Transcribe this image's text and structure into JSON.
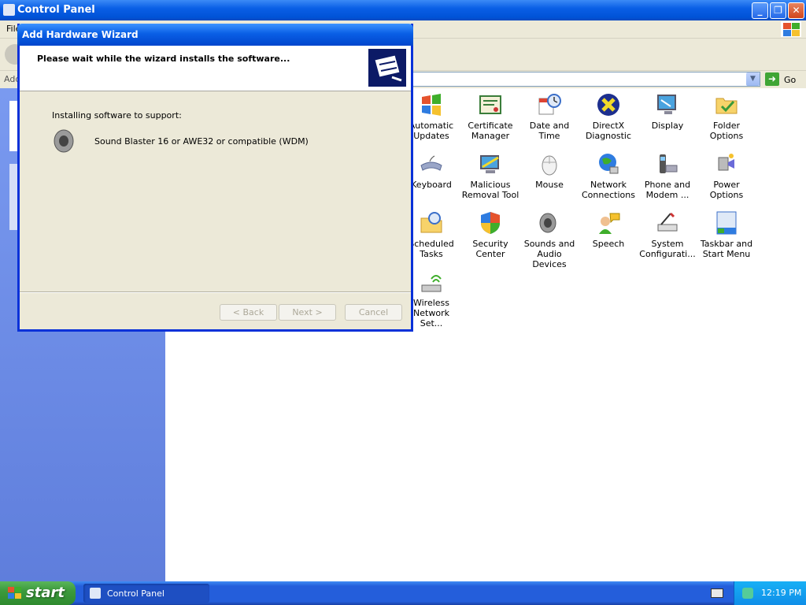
{
  "window": {
    "title": "Control Panel",
    "menu_first": "File",
    "address_label": "Address",
    "go_label": "Go"
  },
  "items": [
    {
      "label": "Automatic Updates",
      "icon": "automatic-updates-icon"
    },
    {
      "label": "Certificate Manager",
      "icon": "certificate-icon"
    },
    {
      "label": "Date and Time",
      "icon": "date-time-icon"
    },
    {
      "label": "DirectX Diagnostic",
      "icon": "directx-icon"
    },
    {
      "label": "Display",
      "icon": "display-icon"
    },
    {
      "label": "Folder Options",
      "icon": "folder-options-icon"
    },
    {
      "label": "Keyboard",
      "icon": "keyboard-icon"
    },
    {
      "label": "Malicious Removal Tool",
      "icon": "malicious-removal-icon"
    },
    {
      "label": "Mouse",
      "icon": "mouse-icon"
    },
    {
      "label": "Network Connections",
      "icon": "network-icon"
    },
    {
      "label": "Phone and Modem ...",
      "icon": "phone-modem-icon"
    },
    {
      "label": "Power Options",
      "icon": "power-options-icon"
    },
    {
      "label": "Scheduled Tasks",
      "icon": "scheduled-tasks-icon"
    },
    {
      "label": "Security Center",
      "icon": "security-shield-icon"
    },
    {
      "label": "Sounds and Audio Devices",
      "icon": "speaker-icon"
    },
    {
      "label": "Speech",
      "icon": "speech-icon"
    },
    {
      "label": "System Configurati...",
      "icon": "system-config-icon"
    },
    {
      "label": "Taskbar and Start Menu",
      "icon": "taskbar-icon"
    },
    {
      "label": "Wireless Network Set...",
      "icon": "wireless-icon"
    }
  ],
  "wizard": {
    "title": "Add Hardware Wizard",
    "header": "Please wait while the wizard installs the software...",
    "body_label": "Installing software to support:",
    "device": "Sound Blaster 16 or AWE32 or compatible (WDM)",
    "back": "< Back",
    "next": "Next >",
    "cancel": "Cancel"
  },
  "taskbar": {
    "start": "start",
    "task": "Control Panel",
    "clock": "12:19 PM"
  },
  "colors": {
    "title_blue": "#0a5fe6",
    "taskbar_blue": "#245edb",
    "start_green": "#3c9a3c",
    "dialog_face": "#ece9d8"
  }
}
